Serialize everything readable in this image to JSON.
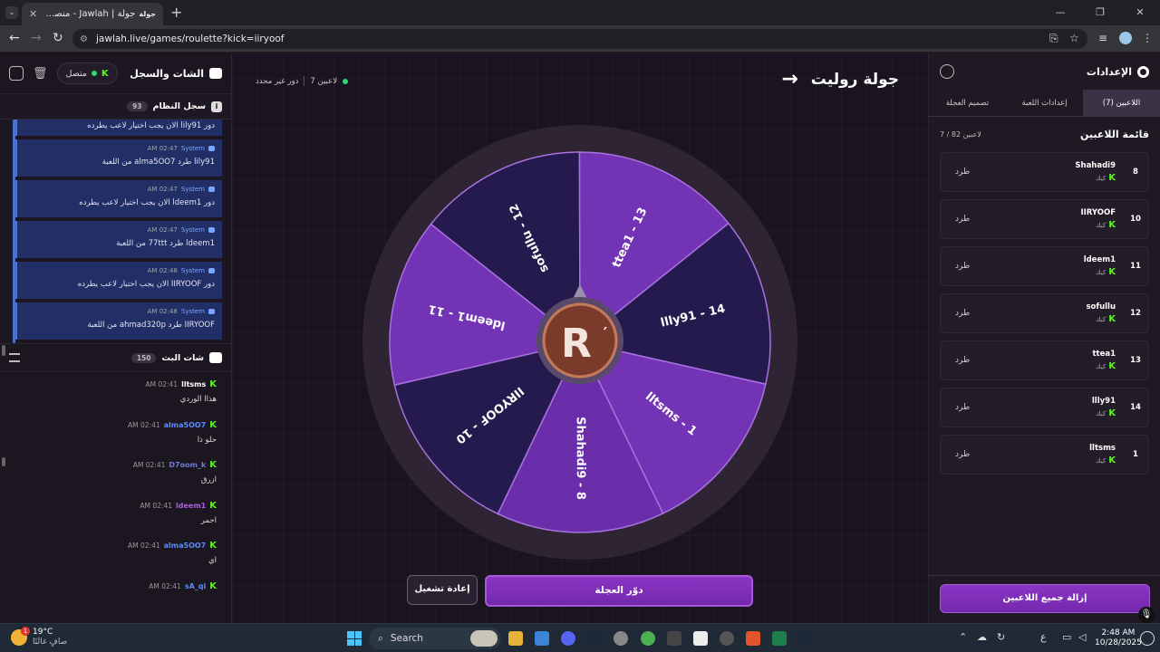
{
  "browser": {
    "tab_title": "جولة | Jawlah - منصة الألعاب التـ",
    "tab_favicon": "جولة",
    "url": "jawlah.live/games/roulette?kick=iiryoof"
  },
  "left": {
    "title": "الشات والسجل",
    "conn_label": "متصل",
    "conn_k": "K",
    "sys_title": "سجل النظام",
    "sys_count": "93",
    "sys_first": "دور lily91 الان يجب اختيار لاعب يطرده",
    "sys_msgs": [
      {
        "time": "02:47 AM",
        "who": "System",
        "text": "lily91 طرد alma5OO7 من اللعبة"
      },
      {
        "time": "02:47 AM",
        "who": "System",
        "text": "دور ldeem1 الان يجب اختيار لاعب يطرده"
      },
      {
        "time": "02:47 AM",
        "who": "System",
        "text": "ldeem1 طرد 77ttt من اللعبة"
      },
      {
        "time": "02:48 AM",
        "who": "System",
        "text": "دور IIRYOOF الان يجب اختيار لاعب يطرده"
      },
      {
        "time": "02:48 AM",
        "who": "System",
        "text": "IIRYOOF طرد ahmad320p من اللعبة"
      }
    ],
    "bc_title": "شات البث",
    "bc_count": "150",
    "bc_msgs": [
      {
        "user": "lltsms",
        "color": "#ffffff",
        "time": "02:41 AM",
        "text": "هذاا الوردي"
      },
      {
        "user": "alma5OO7",
        "color": "#5b8cff",
        "time": "02:41 AM",
        "text": "حلو ذا"
      },
      {
        "user": "D7oom_k",
        "color": "#6f7bd8",
        "time": "02:41 AM",
        "text": "ازرق"
      },
      {
        "user": "ldeem1",
        "color": "#b05ee0",
        "time": "02:41 AM",
        "text": "احمر"
      },
      {
        "user": "alma5OO7",
        "color": "#5b8cff",
        "time": "02:41 AM",
        "text": "اي"
      },
      {
        "user": "sA_qi",
        "color": "#5b8cff",
        "time": "02:41 AM",
        "text": ""
      }
    ]
  },
  "main": {
    "title": "جولة روليت",
    "players_label": "7 لاعبين",
    "turn_label": "دور غير محدد",
    "spin_label": "دوّر العجلة",
    "reset_label": "إعادة تشغيل"
  },
  "chart_data": {
    "type": "pie",
    "categories": [
      "ldeem1 - 11",
      "sofullu - 12",
      "ttea1 - 13",
      "llly91 - 14",
      "lltsms - 1",
      "Shahadi9 - 8",
      "IIRYOOF - 10"
    ],
    "values": [
      1,
      1,
      1,
      1,
      1,
      1,
      1
    ],
    "colors": [
      "#7333b5",
      "#251a4d",
      "#7333b5",
      "#251a4d",
      "#7333b5",
      "#6a2eab",
      "#251a4d"
    ],
    "center_logo": "R"
  },
  "right": {
    "title": "الإعدادات",
    "tabs": [
      "اللاعبين (7)",
      "إعدادات اللعبة",
      "تصميم العجلة"
    ],
    "list_title": "قائمة اللاعبين",
    "list_count": "7 / 82 لاعبين",
    "players": [
      {
        "num": "8",
        "name": "Shahadi9",
        "platform": "كيك",
        "kick": "طرد"
      },
      {
        "num": "10",
        "name": "IIRYOOF",
        "platform": "كيك",
        "kick": "طرد"
      },
      {
        "num": "11",
        "name": "ldeem1",
        "platform": "كيك",
        "kick": "طرد"
      },
      {
        "num": "12",
        "name": "sofullu",
        "platform": "كيك",
        "kick": "طرد"
      },
      {
        "num": "13",
        "name": "ttea1",
        "platform": "كيك",
        "kick": "طرد"
      },
      {
        "num": "14",
        "name": "llly91",
        "platform": "كيك",
        "kick": "طرد"
      },
      {
        "num": "1",
        "name": "lltsms",
        "platform": "كيك",
        "kick": "طرد"
      }
    ],
    "remove_all": "إزالة جميع اللاعبين"
  },
  "taskbar": {
    "temp": "19°C",
    "weather": "صافٍ غالبًا",
    "search": "Search",
    "time": "2:48 AM",
    "date": "10/28/2025",
    "lang": "ع"
  }
}
